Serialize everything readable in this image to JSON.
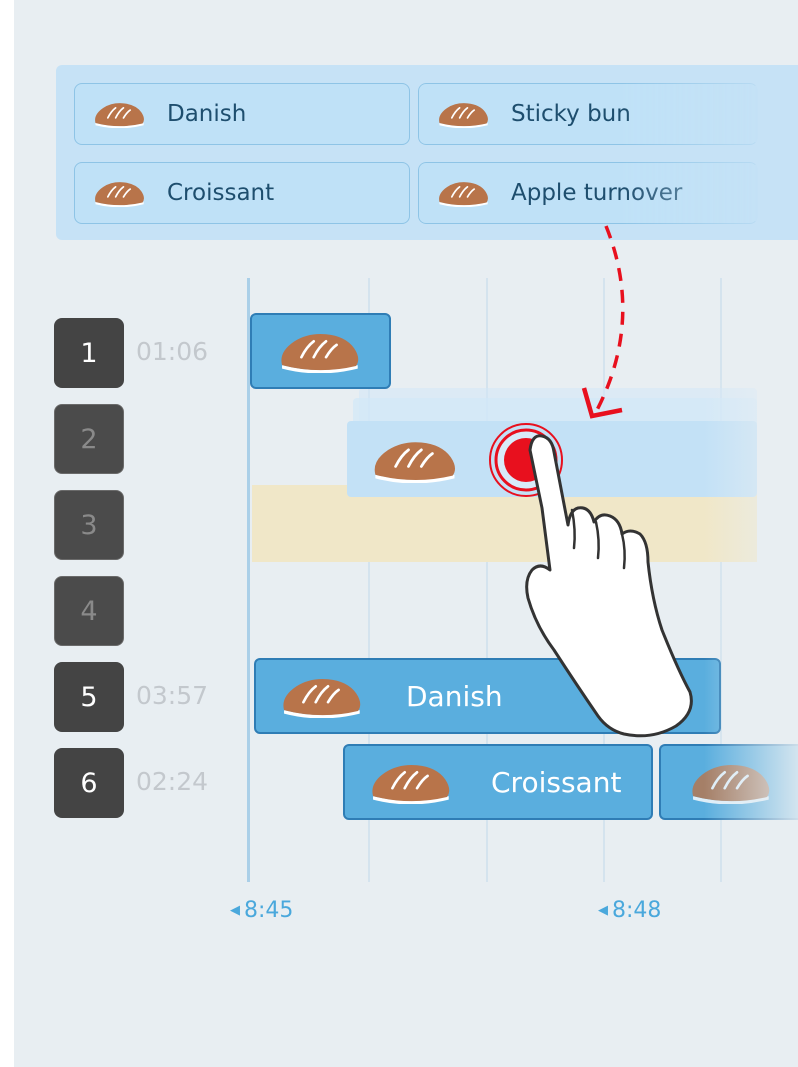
{
  "palette": {
    "items": [
      {
        "label": "Danish"
      },
      {
        "label": "Sticky bun"
      },
      {
        "label": "Croissant"
      },
      {
        "label": "Apple turnover"
      }
    ]
  },
  "lanes": [
    {
      "number": "1",
      "time": "01:06",
      "active": true
    },
    {
      "number": "2",
      "time": "",
      "active": false
    },
    {
      "number": "3",
      "time": "",
      "active": false
    },
    {
      "number": "4",
      "time": "",
      "active": false
    },
    {
      "number": "5",
      "time": "03:57",
      "active": true
    },
    {
      "number": "6",
      "time": "02:24",
      "active": true
    }
  ],
  "blocks": {
    "lane5_label": "Danish",
    "lane6_label": "Croissant"
  },
  "axis": {
    "tick1": "8:45",
    "tick2": "8:48"
  },
  "colors": {
    "accent": "#5aaede",
    "accent_border": "#2f7db5",
    "drop_indicator": "#e8101e",
    "reserved": "#f0e7c8",
    "lane_badge": "#444444"
  },
  "icons": {
    "item": "bread-icon",
    "gesture": "tap-hand-icon",
    "drag_path": "dashed-arrow-icon"
  }
}
